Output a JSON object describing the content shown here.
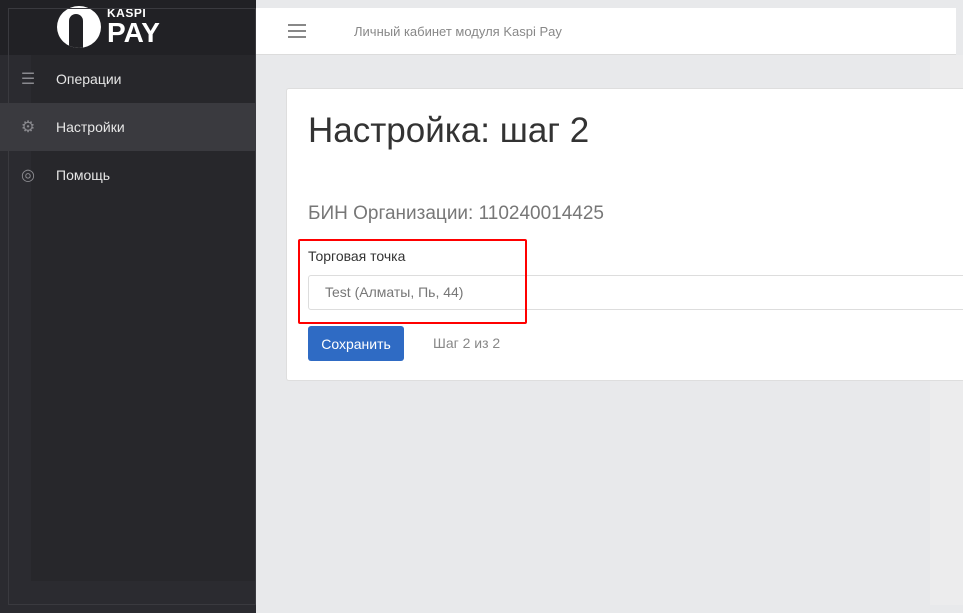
{
  "logo": {
    "top": "KASPI",
    "bottom": "PAY"
  },
  "sidebar": {
    "items": [
      {
        "label": "Операции",
        "icon": "list-icon",
        "active": false
      },
      {
        "label": "Настройки",
        "icon": "gear-icon",
        "active": true
      },
      {
        "label": "Помощь",
        "icon": "lifebuoy-icon",
        "active": false
      }
    ]
  },
  "header": {
    "title": "Личный кабинет модуля Kaspi Pay"
  },
  "page": {
    "title": "Настройка: шаг 2",
    "bin": "БИН Организации: 110240014425",
    "store_label": "Торговая точка",
    "store_value": "Test (Алматы, Пь, 44)",
    "save_label": "Сохранить",
    "step": "Шаг 2 из 2"
  },
  "colors": {
    "accent": "#2f6bc4",
    "highlight": "#ff0000",
    "sidebar": "#2b2b30"
  }
}
